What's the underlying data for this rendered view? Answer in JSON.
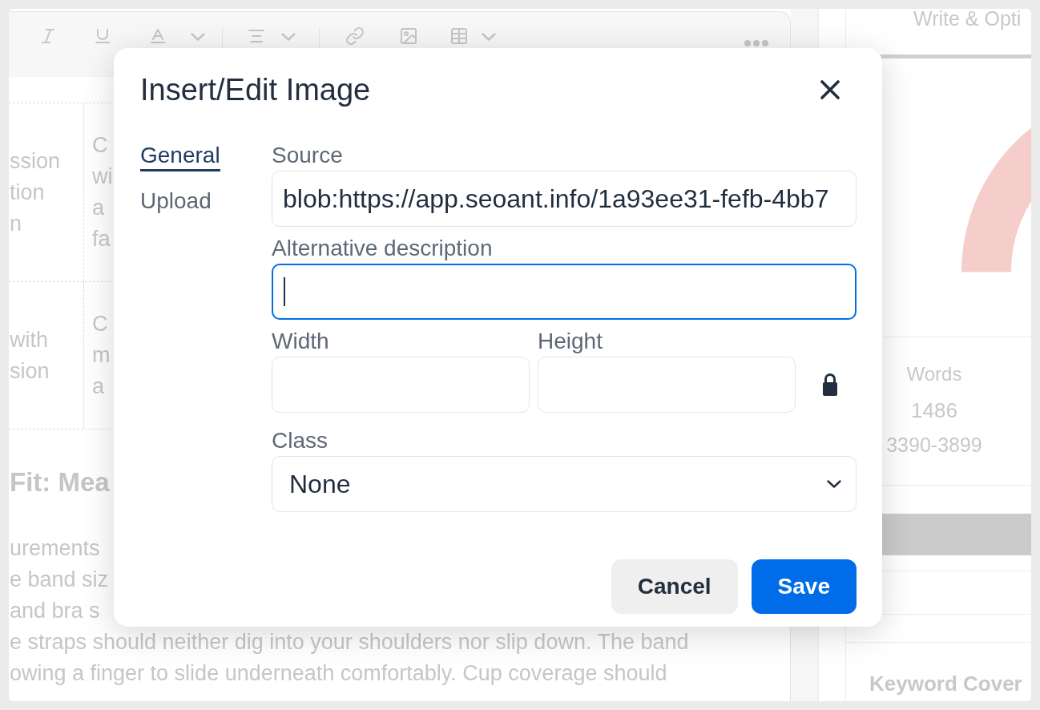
{
  "editor": {
    "table": {
      "rows": [
        {
          "cells": [
            {
              "lines": [
                "ssion",
                "tion",
                "n"
              ]
            },
            {
              "lines": [
                "C",
                "wi",
                "a",
                "fa"
              ]
            }
          ]
        },
        {
          "cells": [
            {
              "lines": [
                "with",
                "sion"
              ]
            },
            {
              "lines": [
                "C",
                "m",
                "a"
              ]
            }
          ]
        }
      ]
    },
    "heading": "Fit: Mea",
    "paragraph_lines": [
      "urements",
      "e band siz",
      "and bra s",
      "e straps should neither dig into your shoulders nor slip down. The band",
      "owing a finger to slide underneath comfortably. Cup coverage should"
    ]
  },
  "side_panel": {
    "title": "Write & Opti",
    "stat": {
      "label": "Words",
      "value": "1486",
      "range": "3390-3899"
    },
    "section_title": "Keyword Cover"
  },
  "dialog": {
    "title": "Insert/Edit Image",
    "tabs": [
      {
        "label": "General",
        "selected": true
      },
      {
        "label": "Upload",
        "selected": false
      }
    ],
    "fields": [
      {
        "kind": "text",
        "label": "Source",
        "value": "blob:https://app.seoant.info/1a93ee31-fefb-4bb7",
        "focused": false
      },
      {
        "kind": "text",
        "label": "Alternative description",
        "focused": true
      },
      {
        "kind": "size",
        "items": [
          {
            "label": "Width"
          },
          {
            "label": "Height"
          }
        ],
        "locked": true
      },
      {
        "kind": "select",
        "label": "Class",
        "value": "None"
      }
    ],
    "buttons": [
      {
        "label": "Cancel",
        "kind": "secondary"
      },
      {
        "label": "Save",
        "kind": "primary"
      }
    ]
  }
}
